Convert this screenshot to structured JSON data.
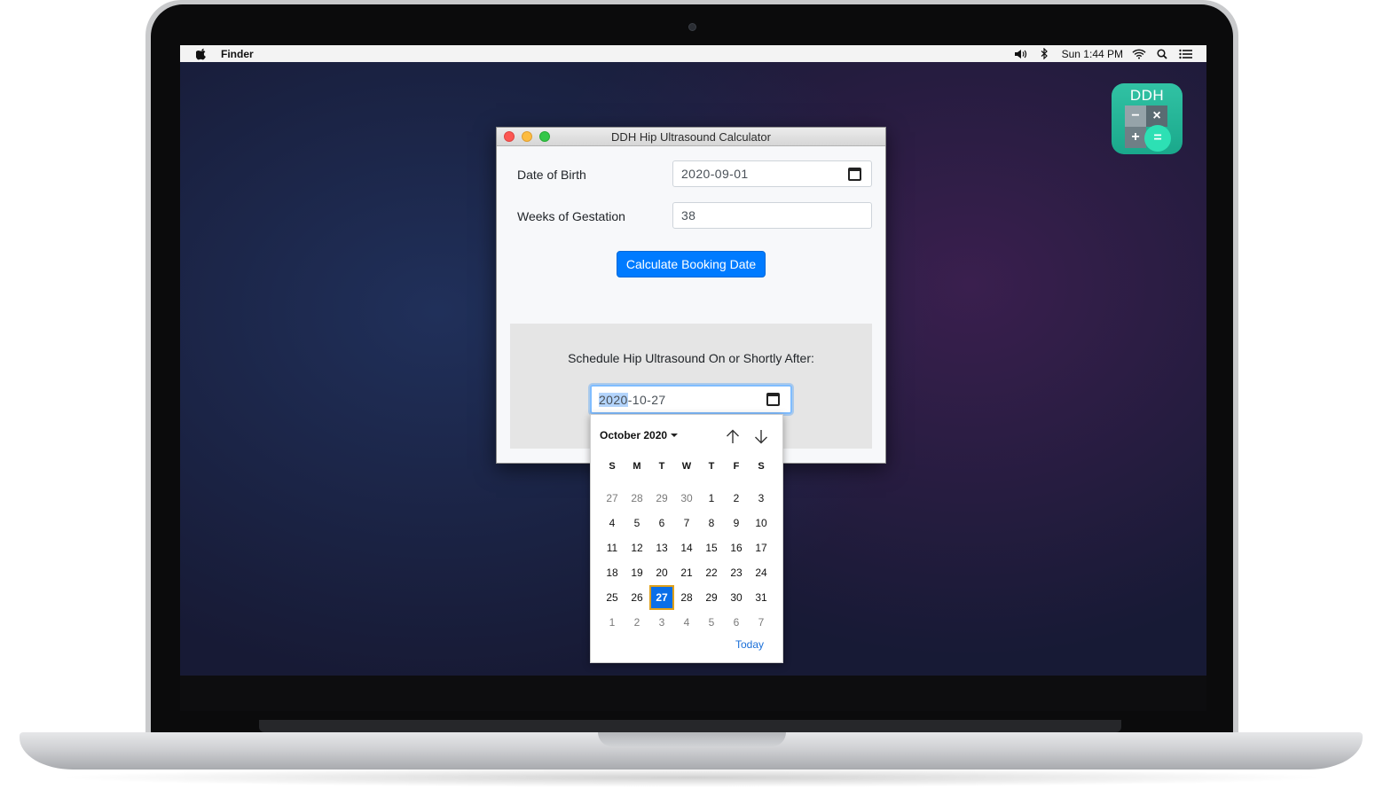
{
  "menubar": {
    "app_name": "Finder",
    "clock": "Sun 1:44 PM",
    "status_icons": [
      "volume-icon",
      "bluetooth-icon",
      "wifi-icon",
      "search-icon",
      "list-icon"
    ]
  },
  "desktop": {
    "app_icon_label": "DDH",
    "app_icon_symbols": {
      "minus": "−",
      "times": "×",
      "plus": "+",
      "equals": "="
    }
  },
  "window": {
    "title": "DDH Hip Ultrasound Calculator",
    "dob_label": "Date of Birth",
    "dob_value": "2020-09-01",
    "gestation_label": "Weeks of Gestation",
    "gestation_value": "38",
    "calculate_button": "Calculate Booking Date",
    "result_label": "Schedule Hip Ultrasound On or Shortly After:",
    "result_year": "2020",
    "result_rest": "-10-27"
  },
  "picker": {
    "month_label": "October 2020",
    "weekdays": [
      "S",
      "M",
      "T",
      "W",
      "T",
      "F",
      "S"
    ],
    "weeks": [
      [
        {
          "d": "27",
          "m": true
        },
        {
          "d": "28",
          "m": true
        },
        {
          "d": "29",
          "m": true
        },
        {
          "d": "30",
          "m": true
        },
        {
          "d": "1"
        },
        {
          "d": "2"
        },
        {
          "d": "3"
        }
      ],
      [
        {
          "d": "4"
        },
        {
          "d": "5"
        },
        {
          "d": "6"
        },
        {
          "d": "7"
        },
        {
          "d": "8"
        },
        {
          "d": "9"
        },
        {
          "d": "10"
        }
      ],
      [
        {
          "d": "11"
        },
        {
          "d": "12"
        },
        {
          "d": "13"
        },
        {
          "d": "14"
        },
        {
          "d": "15"
        },
        {
          "d": "16"
        },
        {
          "d": "17"
        }
      ],
      [
        {
          "d": "18"
        },
        {
          "d": "19"
        },
        {
          "d": "20"
        },
        {
          "d": "21"
        },
        {
          "d": "22"
        },
        {
          "d": "23"
        },
        {
          "d": "24"
        }
      ],
      [
        {
          "d": "25"
        },
        {
          "d": "26"
        },
        {
          "d": "27",
          "sel": true
        },
        {
          "d": "28"
        },
        {
          "d": "29"
        },
        {
          "d": "30"
        },
        {
          "d": "31"
        }
      ],
      [
        {
          "d": "1",
          "m": true
        },
        {
          "d": "2",
          "m": true
        },
        {
          "d": "3",
          "m": true
        },
        {
          "d": "4",
          "m": true
        },
        {
          "d": "5",
          "m": true
        },
        {
          "d": "6",
          "m": true
        },
        {
          "d": "7",
          "m": true
        }
      ]
    ],
    "today_link": "Today"
  },
  "colors": {
    "accent": "#007bff",
    "selected_day": "#0a6fe8",
    "selected_outline": "#e0a11a",
    "app_icon": "#1aa88b"
  }
}
